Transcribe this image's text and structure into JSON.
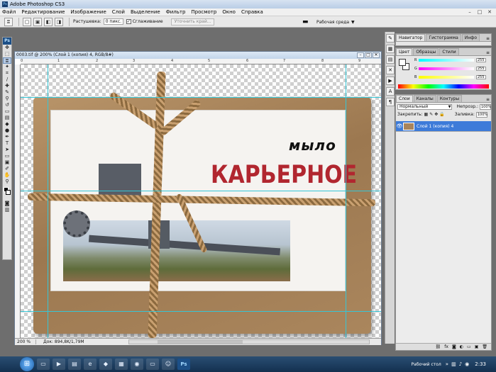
{
  "window": {
    "title": "Adobe Photoshop CS3"
  },
  "menu": [
    "Файл",
    "Редактирование",
    "Изображение",
    "Слой",
    "Выделение",
    "Фильтр",
    "Просмотр",
    "Окно",
    "Справка"
  ],
  "options": {
    "feather_label": "Растушевка:",
    "feather_value": "0 пикс.",
    "antialias_label": "Сглаживание",
    "refine_edge": "Уточнить край...",
    "workspace": "Рабочая среда"
  },
  "document": {
    "title": "0003.tif @ 200% (Слой 1 (копия) 4, RGB/8#)",
    "zoom": "200 %",
    "doc_info": "Док: 894,8K/1,79M",
    "text_small": "мыло",
    "text_big": "КАРЬЕРНОЕ",
    "ruler_ticks": [
      "0",
      "1",
      "2",
      "3",
      "4",
      "5",
      "6",
      "7",
      "8",
      "9"
    ]
  },
  "panels": {
    "nav_tabs": [
      "Навигатор",
      "Гистограмма",
      "Инфо"
    ],
    "color_tabs": [
      "Цвет",
      "Образцы",
      "Стили"
    ],
    "color_channels": [
      {
        "letter": "R",
        "value": "255"
      },
      {
        "letter": "G",
        "value": "255"
      },
      {
        "letter": "B",
        "value": "255"
      }
    ],
    "layers_tabs": [
      "Слои",
      "Каналы",
      "Контуры"
    ],
    "blend_mode": "Нормальный",
    "opacity_label": "Непрозр.:",
    "opacity_value": "100%",
    "lock_label": "Закрепить:",
    "fill_label": "Заливка:",
    "fill_value": "100%",
    "layer_name": "Слой 1 (копия) 4"
  },
  "taskbar": {
    "desktop_label": "Рабочий стол",
    "clock": "2:33",
    "ps_label": "Ps"
  },
  "colors": {
    "accent_layer": "#3d7bd9",
    "brand_red": "#b1262f"
  }
}
